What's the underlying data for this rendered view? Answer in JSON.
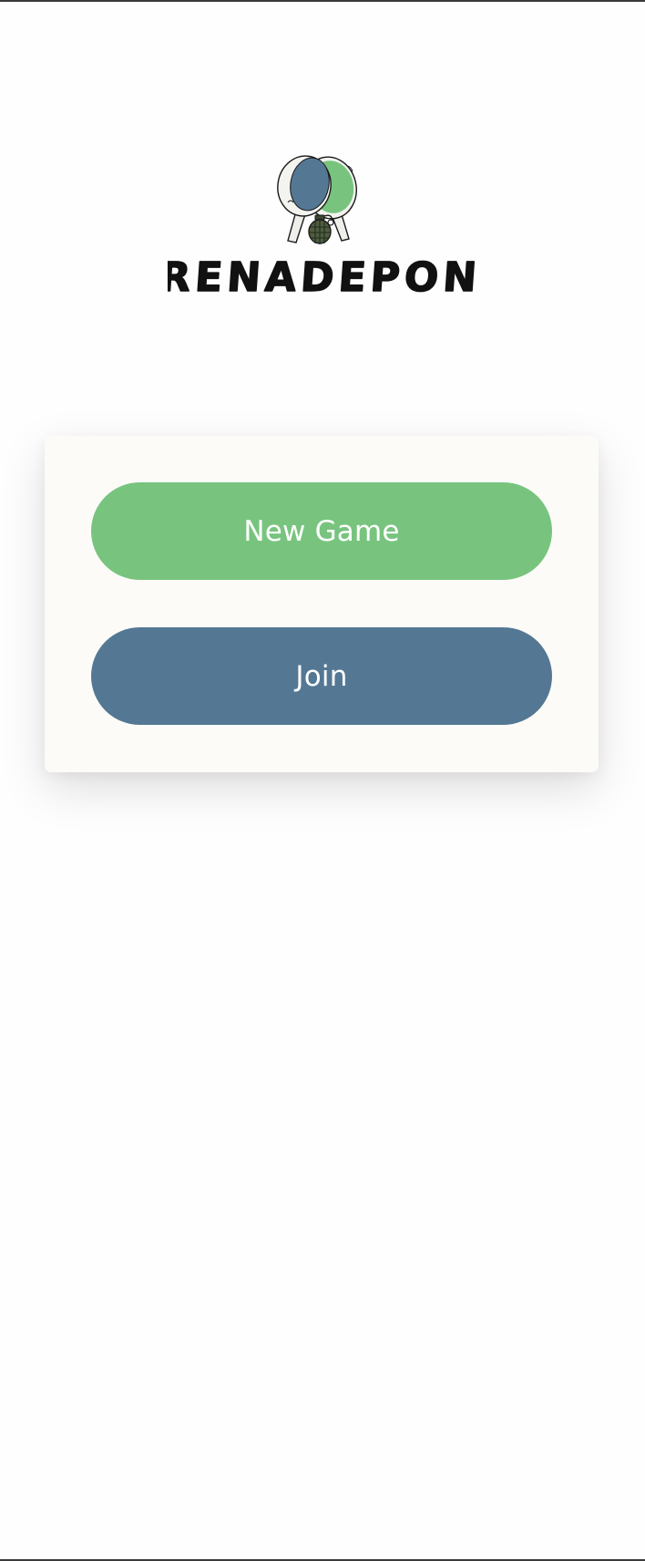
{
  "app": {
    "name": "GRENADEPONG"
  },
  "logo": {
    "icon": "crossed-ping-pong-paddles-with-grenade",
    "colors": {
      "paddle_left": "#547894",
      "paddle_right": "#78c47f",
      "grenade": "#4e5c40",
      "outline": "#1a1a1a"
    }
  },
  "menu": {
    "new_game_label": "New Game",
    "join_label": "Join"
  },
  "colors": {
    "background": "#fefefe",
    "card": "#fcfbf8",
    "new_game": "#78c47f",
    "join": "#547894",
    "button_text": "#ffffff"
  }
}
